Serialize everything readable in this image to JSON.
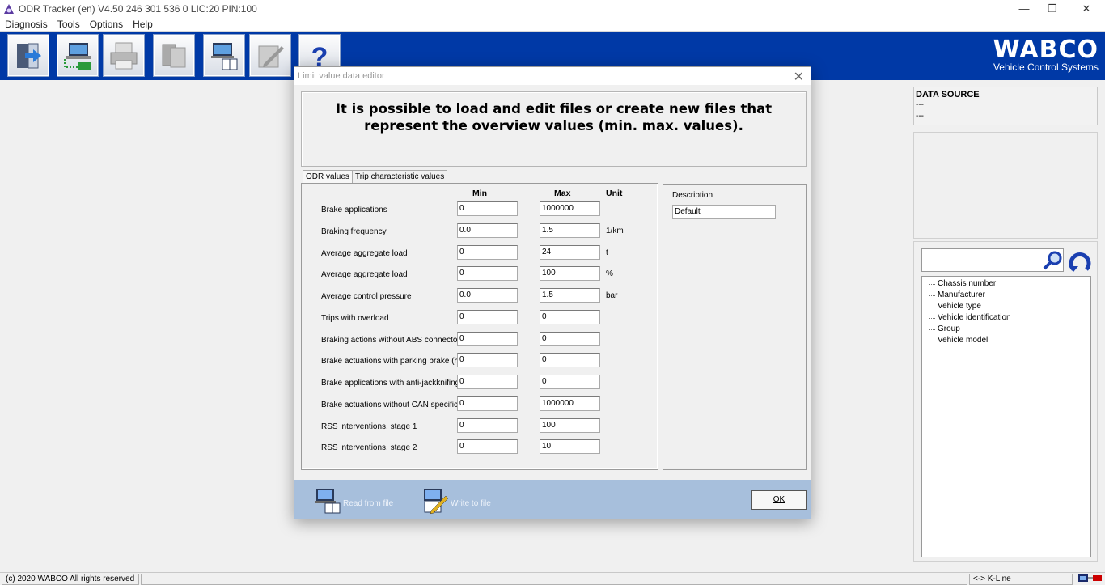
{
  "window": {
    "title": "ODR Tracker (en) V4.50   246 301 536 0  LIC:20 PIN:100"
  },
  "menu": [
    "Diagnosis",
    "Tools",
    "Options",
    "Help"
  ],
  "toolbar": {
    "buttons": [
      {
        "icon": "exit-icon"
      },
      {
        "icon": "ecu-connect-icon"
      },
      {
        "icon": "printer-icon"
      },
      {
        "icon": "documents-icon"
      },
      {
        "icon": "laptop-book-icon"
      },
      {
        "icon": "edit-pencil-icon"
      },
      {
        "icon": "help-icon"
      }
    ],
    "help_glyph": "?",
    "brand": "WABCO",
    "brand_tagline": "Vehicle Control Systems",
    "bg_color": "#0039a6"
  },
  "data_source": {
    "title": "DATA SOURCE",
    "line1": "---",
    "line2": "---"
  },
  "tree": {
    "items": [
      "Chassis number",
      "Manufacturer",
      "Vehicle type",
      "Vehicle identification",
      "Group",
      "Vehicle model"
    ]
  },
  "status": {
    "copyright": "(c) 2020 WABCO All rights reserved",
    "connection": "<-> K-Line"
  },
  "dialog": {
    "title": "Limit value data editor",
    "close_glyph": "✕",
    "heading": "It is possible to load and edit files or create new files that represent the overview values (min. max. values).",
    "tabs": [
      "ODR values",
      "Trip characteristic values"
    ],
    "columns": {
      "min": "Min",
      "max": "Max",
      "unit": "Unit"
    },
    "rows": [
      {
        "label": "Brake applications",
        "min": "0",
        "max": "1000000",
        "unit": ""
      },
      {
        "label": "Braking frequency",
        "min": "0.0",
        "max": "1.5",
        "unit": "1/km"
      },
      {
        "label": "Average aggregate load",
        "min": "0",
        "max": "24",
        "unit": "t"
      },
      {
        "label": "Average aggregate load",
        "min": "0",
        "max": "100",
        "unit": "%"
      },
      {
        "label": "Average control pressure",
        "min": "0.0",
        "max": "1.5",
        "unit": "bar"
      },
      {
        "label": "Trips with overload",
        "min": "0",
        "max": "0",
        "unit": ""
      },
      {
        "label": "Braking actions without ABS connector",
        "min": "0",
        "max": "0",
        "unit": ""
      },
      {
        "label": "Brake actuations with parking brake (ha",
        "min": "0",
        "max": "0",
        "unit": ""
      },
      {
        "label": "Brake applications with anti-jackknifing",
        "min": "0",
        "max": "0",
        "unit": ""
      },
      {
        "label": "Brake actuations without CAN specifica",
        "min": "0",
        "max": "1000000",
        "unit": ""
      },
      {
        "label": "RSS interventions, stage 1",
        "min": "0",
        "max": "100",
        "unit": ""
      },
      {
        "label": "RSS interventions, stage 2",
        "min": "0",
        "max": "10",
        "unit": ""
      }
    ],
    "description_label": "Description",
    "description_value": "Default",
    "read_label": "Read from file",
    "write_label": "Write to file",
    "ok_label": "OK",
    "footer_color": "#a7bfdc"
  }
}
